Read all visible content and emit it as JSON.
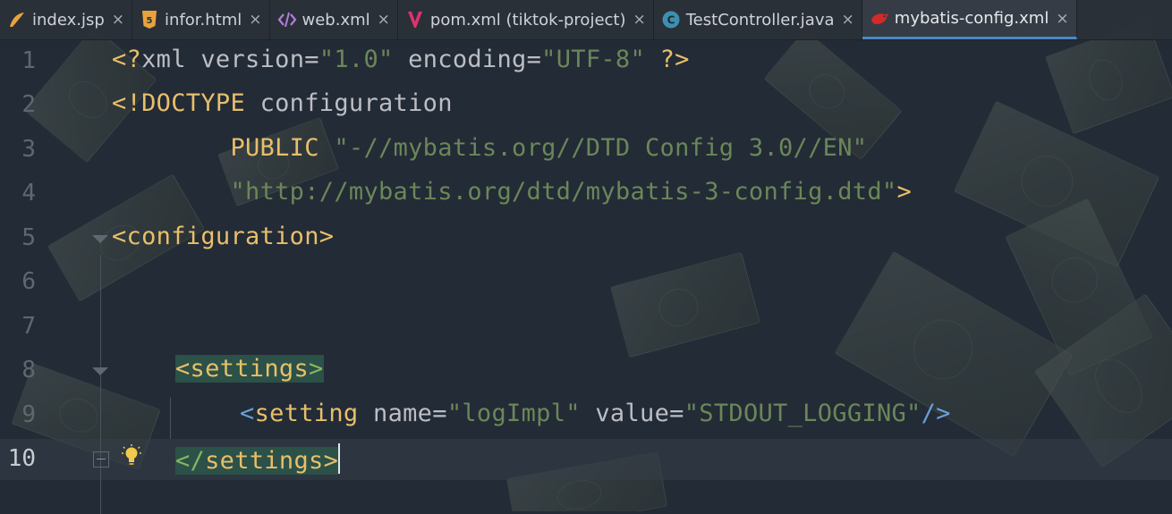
{
  "tabs": [
    {
      "label": "index.jsp",
      "icon": "jsp-icon",
      "active": false
    },
    {
      "label": "infor.html",
      "icon": "html5-icon",
      "active": false
    },
    {
      "label": "web.xml",
      "icon": "xml-tag-icon",
      "active": false
    },
    {
      "label": "pom.xml (tiktok-project)",
      "icon": "maven-icon",
      "active": false
    },
    {
      "label": "TestController.java",
      "icon": "java-class-icon",
      "active": false
    },
    {
      "label": "mybatis-config.xml",
      "icon": "mybatis-bird-icon",
      "active": true
    }
  ],
  "close_glyph": "×",
  "line_numbers": [
    "1",
    "2",
    "3",
    "4",
    "5",
    "6",
    "7",
    "8",
    "9",
    "10"
  ],
  "current_line": "10",
  "code": {
    "l1": {
      "a": "<?",
      "b": "xml ",
      "c": "version",
      "d": "=",
      "e": "\"1.0\"",
      "f": " encoding",
      "g": "=",
      "h": "\"UTF-8\"",
      "i": " ?>"
    },
    "l2": {
      "a": "<!DOCTYPE ",
      "b": "configuration"
    },
    "l3": {
      "a": "        PUBLIC ",
      "b": "\"-//mybatis.org//DTD Config 3.0//EN\""
    },
    "l4": {
      "a": "        ",
      "b": "\"http://mybatis.org/dtd/mybatis-3-config.dtd\"",
      "c": ">"
    },
    "l5": {
      "a": "<configuration>"
    },
    "l8": {
      "a": "<settings",
      "b": ">"
    },
    "l9": {
      "a": "<",
      "b": "setting ",
      "c": "name",
      "d": "=",
      "e": "\"logImpl\"",
      "f": " value",
      "g": "=",
      "h": "\"STDOUT_LOGGING\"",
      "i": "/",
      "j": ">"
    },
    "l10": {
      "a": "</",
      "b": "settings",
      "c": ">"
    }
  },
  "colors": {
    "active_tab_underline": "#4a88c7",
    "tag": "#e8bf6a",
    "string": "#6a8759",
    "matched_tag_highlight": "#2c5148"
  }
}
